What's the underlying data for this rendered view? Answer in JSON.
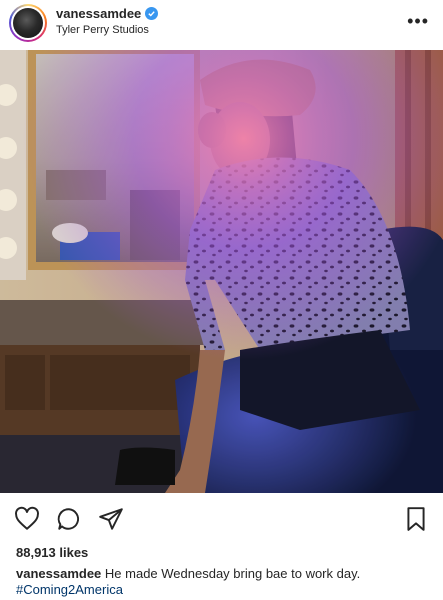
{
  "post": {
    "username": "vanessamdee",
    "location": "Tyler Perry Studios",
    "more_label": "•••",
    "likes_text": "88,913 likes",
    "caption_username": "vanessamdee",
    "caption_text": "He made Wednesday bring bae to work day.",
    "hashtag": "#Coming2America"
  },
  "icons": {
    "avatar": "avatar",
    "verified": "verified-badge-icon",
    "like": "heart-icon",
    "comment": "comment-icon",
    "share": "share-icon",
    "save": "bookmark-icon",
    "more": "more-icon"
  },
  "colors": {
    "verified": "#3897f0",
    "hashtag": "#003569",
    "text": "#262626"
  }
}
